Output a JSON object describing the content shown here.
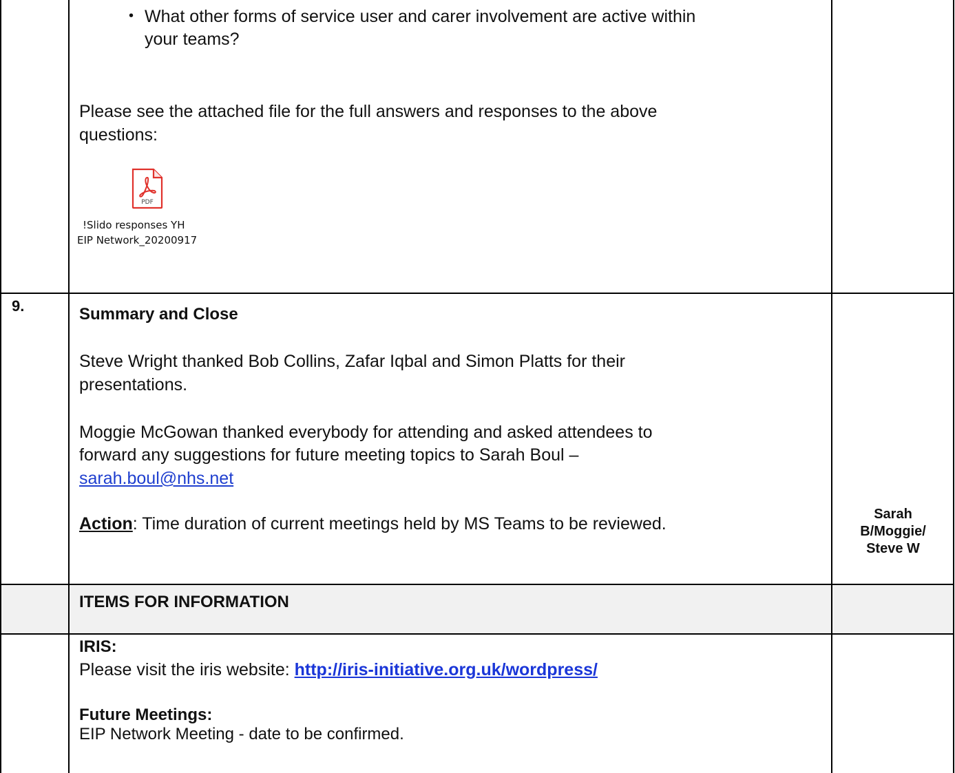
{
  "row_8": {
    "bullet_text_1": "What other forms of service user and carer involvement are active within",
    "bullet_text_2": "your teams?",
    "attached_line_1": "Please see the attached file for the full answers and responses to the above",
    "attached_line_2": "questions:",
    "pdf_icon_label": "PDF",
    "pdf_caption_1": "!Slido responses YH",
    "pdf_caption_2": "EIP Network_20200917"
  },
  "row_9": {
    "number": "9.",
    "heading": "Summary and Close",
    "para1_line1": "Steve Wright thanked Bob Collins, Zafar Iqbal and Simon Platts for their",
    "para1_line2": "presentations.",
    "para2_line1": "Moggie McGowan thanked everybody for attending and asked attendees to",
    "para2_line2": "forward any suggestions for future meeting topics to Sarah Boul –",
    "email": "sarah.boul@nhs.net",
    "action_label": "Action",
    "action_text": ":  Time duration of current meetings held by MS Teams to be reviewed.",
    "owner_1": "Sarah",
    "owner_2": "B/Moggie/",
    "owner_3": "Steve W"
  },
  "info_header": "ITEMS FOR INFORMATION",
  "info": {
    "iris_heading": "IRIS:",
    "iris_text": "Please visit the iris website: ",
    "iris_link": "http://iris-initiative.org.uk/wordpress/",
    "future_heading": "Future Meetings:",
    "future_text": "EIP Network Meeting - date to be confirmed."
  },
  "colors": {
    "link": "#1a36d8",
    "pdf_red": "#e0312b",
    "header_shade": "#f1f1f1"
  }
}
